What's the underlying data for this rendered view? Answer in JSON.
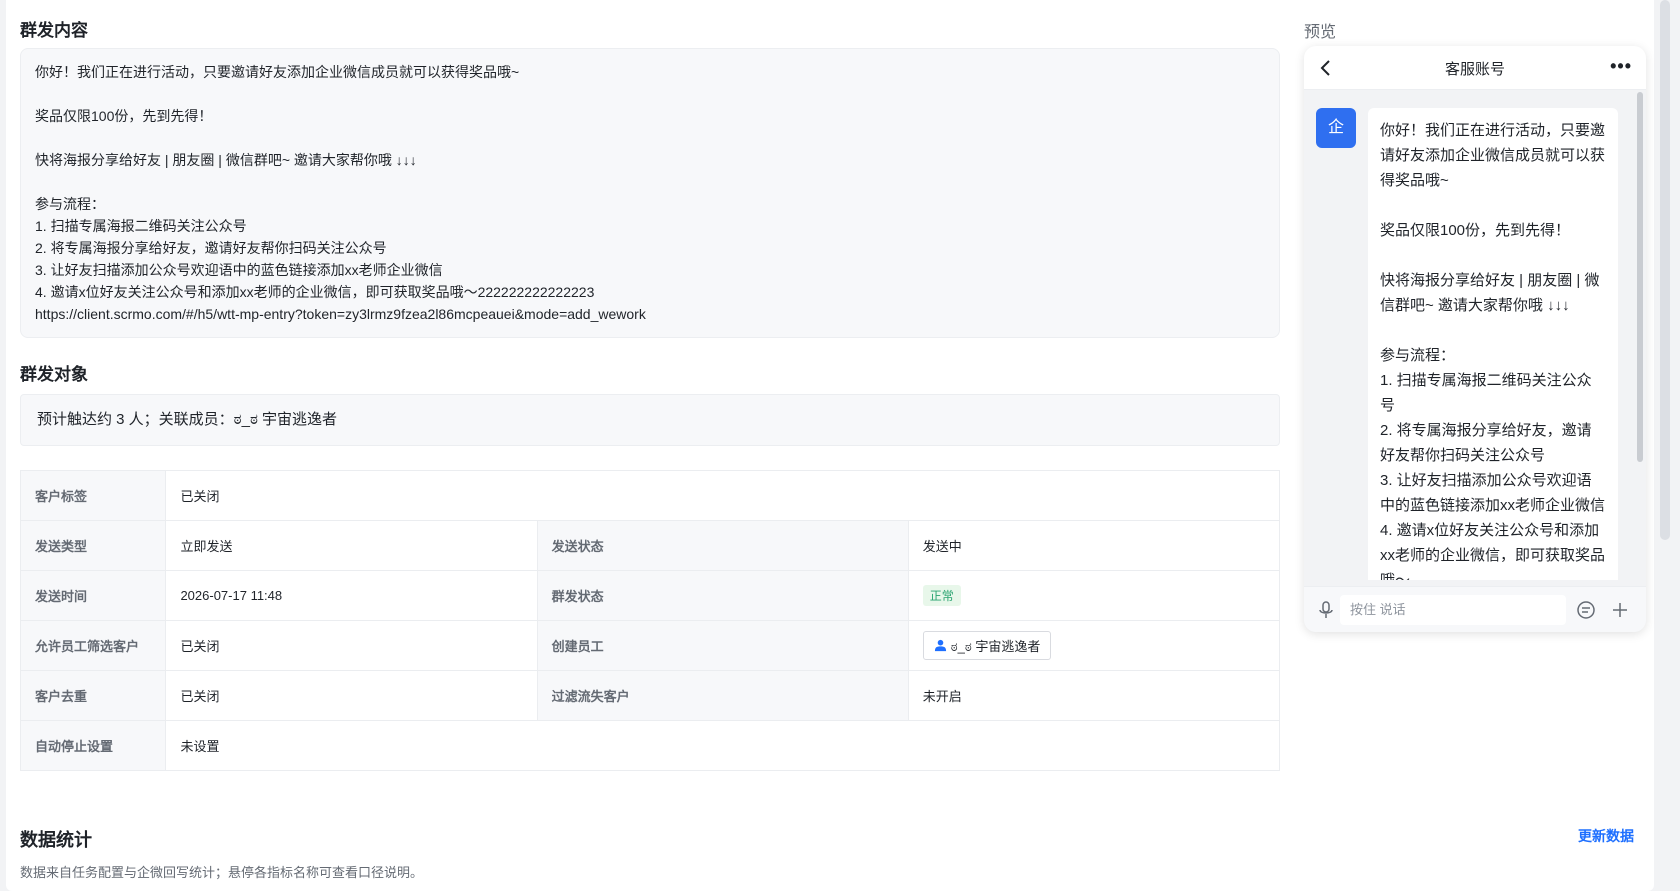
{
  "broadcast": {
    "content_title": "群发内容",
    "content": "你好！我们正在进行活动，只要邀请好友添加企业微信成员就可以获得奖品哦~\n\n奖品仅限100份，先到先得！\n\n快将海报分享给好友 | 朋友圈 | 微信群吧~ 邀请大家帮你哦 ↓↓↓\n\n参与流程：\n1. 扫描专属海报二维码关注公众号\n2. 将专属海报分享给好友，邀请好友帮你扫码关注公众号\n3. 让好友扫描添加公众号欢迎语中的蓝色链接添加xx老师企业微信\n4. 邀请x位好友关注公众号和添加xx老师的企业微信，即可获取奖品哦～222222222222223\nhttps://client.scrmo.com/#/h5/wtt-mp-entry?token=zy3lrmz9fzea2l86mcpeauei&mode=add_wework",
    "target_title": "群发对象",
    "target_text": "预计触达约 3 人；关联成员：ಠ_ಠ 宇宙逃逸者"
  },
  "info": {
    "customer_tag_label": "客户标签",
    "customer_tag_value": "已关闭",
    "send_type_label": "发送类型",
    "send_type_value": "立即发送",
    "send_status_label": "发送状态",
    "send_status_value": "发送中",
    "send_time_label": "发送时间",
    "send_time_value": "2026-07-17 11:48",
    "broadcast_status_label": "群发状态",
    "broadcast_status_value": "正常",
    "allow_filter_label": "允许员工筛选客户",
    "allow_filter_value": "已关闭",
    "creator_label": "创建员工",
    "creator_value": "ಠ_ಠ 宇宙逃逸者",
    "dedupe_label": "客户去重",
    "dedupe_value": "已关闭",
    "filter_lost_label": "过滤流失客户",
    "filter_lost_value": "未开启",
    "auto_stop_label": "自动停止设置",
    "auto_stop_value": "未设置"
  },
  "stats": {
    "title": "数据统计",
    "desc": "数据来自任务配置与企微回写统计；悬停各指标名称可查看口径说明。",
    "refresh_label": "更新数据"
  },
  "preview": {
    "label": "预览",
    "phone_title": "客服账号",
    "more": "•••",
    "avatar_char": "企",
    "bubble": "你好！我们正在进行活动，只要邀请好友添加企业微信成员就可以获得奖品哦~\n\n奖品仅限100份，先到先得！\n\n快将海报分享给好友 | 朋友圈 | 微信群吧~ 邀请大家帮你哦 ↓↓↓\n\n参与流程：\n1. 扫描专属海报二维码关注公众号\n2. 将专属海报分享给好友，邀请好友帮你扫码关注公众号\n3. 让好友扫描添加公众号欢迎语中的蓝色链接添加xx老师企业微信\n4. 邀请x位好友关注公众号和添加xx老师的企业微信，即可获取奖品哦～",
    "speak_placeholder": "按住 说话"
  },
  "icons": [
    "back-icon",
    "more-icon",
    "mic-icon",
    "emoji-icon",
    "plus-icon",
    "user-icon"
  ],
  "colors": {
    "accent": "#1e6fff",
    "avatar": "#2f6ff0",
    "status_green": "#2ba471"
  }
}
